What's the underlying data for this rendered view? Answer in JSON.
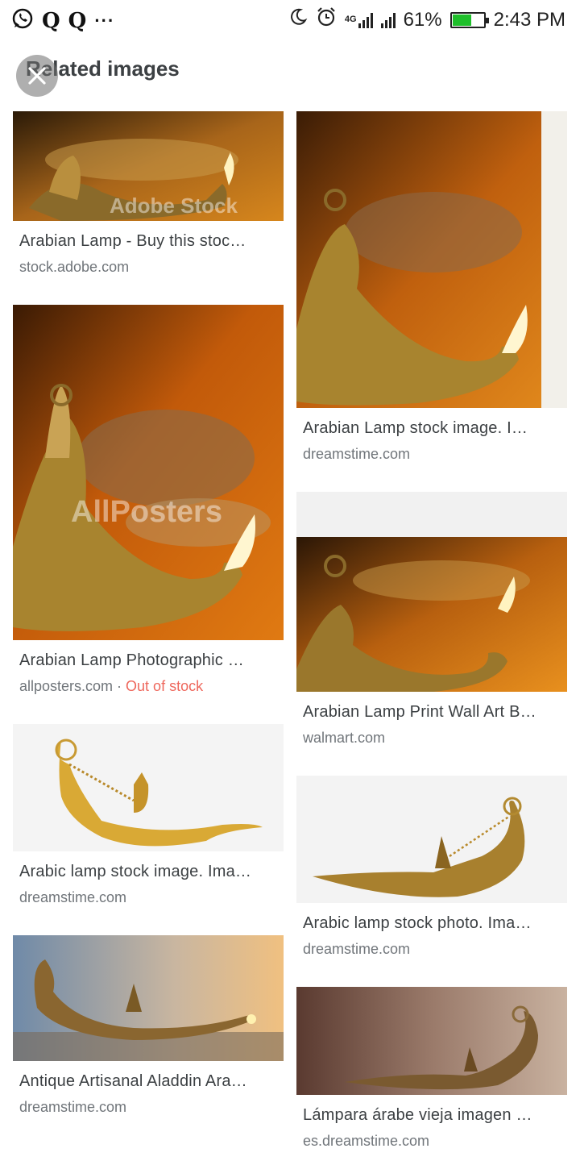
{
  "status_bar": {
    "left_icons": [
      "whatsapp-icon",
      "q-app-icon",
      "q-app-icon",
      "more-dots-icon"
    ],
    "q_label": "Q",
    "dots": "···",
    "network": "4G",
    "battery_percent": "61%",
    "battery_level": 0.61,
    "time": "2:43 PM"
  },
  "header": {
    "title": "Related images"
  },
  "results": [
    {
      "title": "Arabian Lamp - Buy this stoc…",
      "source": "stock.adobe.com",
      "extra": "",
      "watermark": "Adobe Stock"
    },
    {
      "title": "Arabian Lamp stock image. I…",
      "source": "dreamstime.com",
      "extra": "",
      "watermark": ""
    },
    {
      "title": "Arabian Lamp Photographic …",
      "source": "allposters.com",
      "separator": " · ",
      "extra": "Out of stock",
      "watermark": "AllPosters"
    },
    {
      "title": "Arabian Lamp Print Wall Art B…",
      "source": "walmart.com",
      "extra": "",
      "watermark": ""
    },
    {
      "title": "Arabic lamp stock image. Ima…",
      "source": "dreamstime.com",
      "extra": "",
      "watermark": ""
    },
    {
      "title": "Arabic lamp stock photo. Ima…",
      "source": "dreamstime.com",
      "extra": "",
      "watermark": ""
    },
    {
      "title": "Antique Artisanal Aladdin Ara…",
      "source": "dreamstime.com",
      "extra": "",
      "watermark": ""
    },
    {
      "title": "Lámpara árabe vieja imagen …",
      "source": "es.dreamstime.com",
      "extra": "",
      "watermark": ""
    }
  ],
  "colors": {
    "out_of_stock": "#ee675c",
    "battery_fill": "#1fbf2b"
  }
}
